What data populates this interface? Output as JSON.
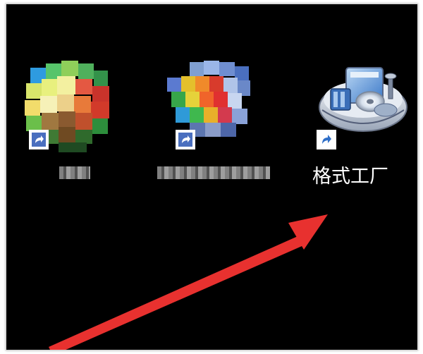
{
  "desktop": {
    "background_color": "#000000",
    "icons": [
      {
        "name": "blurred-app-1",
        "label_visible": false
      },
      {
        "name": "blurred-app-2",
        "label_visible": false
      },
      {
        "name": "format-factory",
        "label": "格式工厂",
        "icon": "format-factory-icon",
        "shortcut": true
      }
    ]
  },
  "annotation": {
    "arrow_color": "#e8312f"
  }
}
